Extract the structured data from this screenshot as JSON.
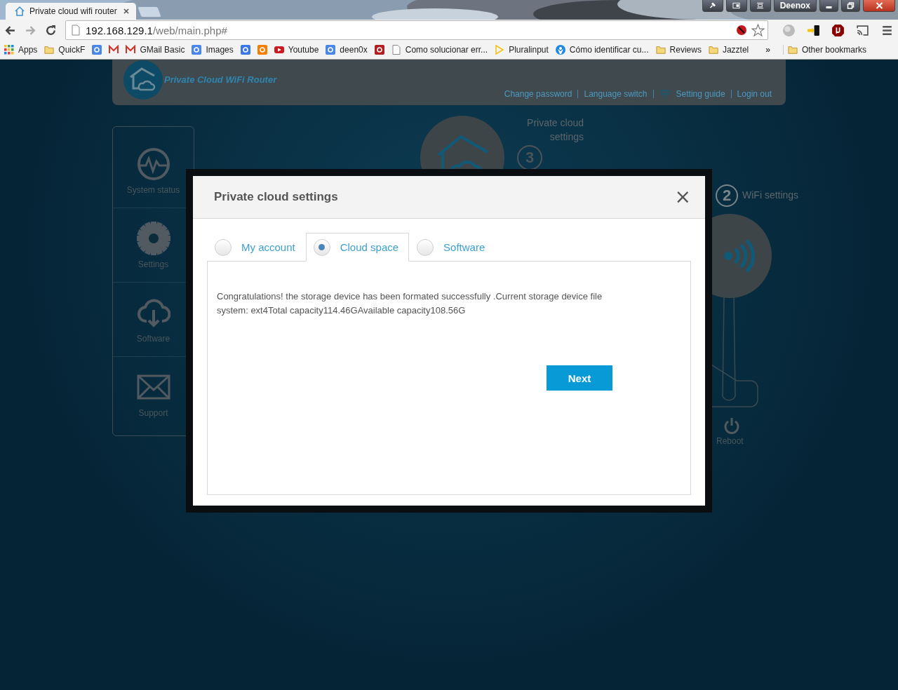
{
  "browser": {
    "tab": {
      "title": "Private cloud wifi router"
    },
    "profile": "Deenox",
    "url": {
      "host": "192.168.129.1",
      "path": "/web/main.php#"
    },
    "bookmarks": [
      {
        "kind": "apps",
        "label": "Apps"
      },
      {
        "kind": "folder",
        "label": "QuickF"
      },
      {
        "kind": "google"
      },
      {
        "kind": "gmail"
      },
      {
        "kind": "gmail",
        "label": "GMail Basic"
      },
      {
        "kind": "google",
        "label": "Images"
      },
      {
        "kind": "translate"
      },
      {
        "kind": "blogger"
      },
      {
        "kind": "youtube",
        "label": "Youtube"
      },
      {
        "kind": "google",
        "label": "deen0x"
      },
      {
        "kind": "pdf"
      },
      {
        "kind": "page",
        "label": "Como solucionar err..."
      },
      {
        "kind": "plural",
        "label": "Pluralinput"
      },
      {
        "kind": "person",
        "label": "Cómo identificar cu..."
      },
      {
        "kind": "folder",
        "label": "Reviews"
      },
      {
        "kind": "folder",
        "label": "Jazztel"
      }
    ],
    "more": "»",
    "other_bookmarks": "Other bookmarks"
  },
  "header": {
    "brand": "Private Cloud WiFi Router",
    "links": [
      "Change password",
      "Language switch",
      "Setting guide",
      "Login out"
    ]
  },
  "sidebar": [
    {
      "kind": "pulse",
      "label": "System status"
    },
    {
      "kind": "gear",
      "label": "Settings"
    },
    {
      "kind": "cloud",
      "label": "Software"
    },
    {
      "kind": "mail",
      "label": "Support"
    }
  ],
  "steps": [
    {
      "number": "3",
      "label": "Private cloud settings"
    },
    {
      "number": "2",
      "label": "WiFi settings"
    }
  ],
  "reboot": "Reboot",
  "dialog": {
    "title": "Private cloud settings",
    "close": "×",
    "tabs": [
      {
        "label": "My account",
        "selected": false
      },
      {
        "label": "Cloud space",
        "selected": true
      },
      {
        "label": "Software",
        "selected": false
      }
    ],
    "message": "Congratulations! the storage device has been formated successfully .Current storage device file system: ext4Total capacity114.46GAvailable capacity108.56G",
    "button": "Next"
  }
}
